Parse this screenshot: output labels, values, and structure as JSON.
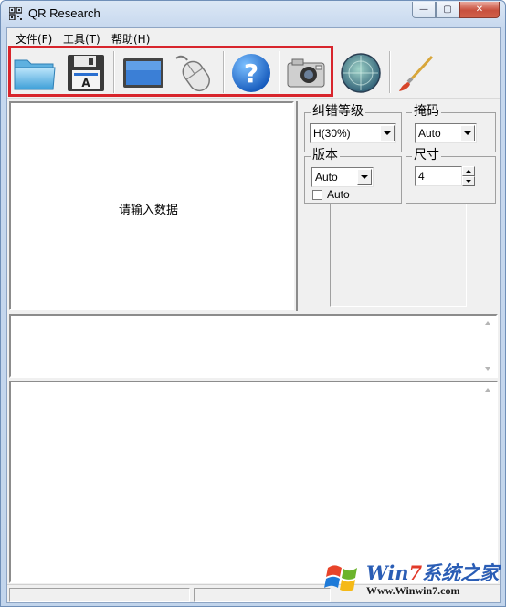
{
  "window": {
    "title": "QR Research",
    "minimize_glyph": "—",
    "maximize_glyph": "▢",
    "close_glyph": "✕"
  },
  "menu": {
    "items": [
      "文件(F)",
      "工具(T)",
      "帮助(H)"
    ]
  },
  "toolbar": {
    "buttons": [
      {
        "name": "open-folder",
        "icon": "folder-icon"
      },
      {
        "name": "save",
        "icon": "floppy-disk-icon"
      },
      {
        "name": "screen-capture",
        "icon": "monitor-icon"
      },
      {
        "name": "mouse-decode",
        "icon": "mouse-icon"
      },
      {
        "name": "help",
        "icon": "help-icon"
      },
      {
        "name": "camera",
        "icon": "camera-icon"
      },
      {
        "name": "radar",
        "icon": "radar-icon"
      },
      {
        "name": "brush",
        "icon": "brush-icon"
      }
    ],
    "highlight_color": "#d8252c"
  },
  "data_panel": {
    "placeholder_text": "请输入数据"
  },
  "settings": {
    "error_correction": {
      "label": "纠错等级",
      "value": "H(30%)"
    },
    "mask": {
      "label": "掩码",
      "value": "Auto"
    },
    "version": {
      "label": "版本",
      "value": "Auto",
      "auto_checkbox_label": "Auto",
      "auto_checked": false
    },
    "size": {
      "label": "尺寸",
      "value": "4"
    }
  },
  "watermark": {
    "brand_win": "Win",
    "brand_seven": "7",
    "brand_cn": "系统之家",
    "url": "Www.Winwin7.com"
  }
}
